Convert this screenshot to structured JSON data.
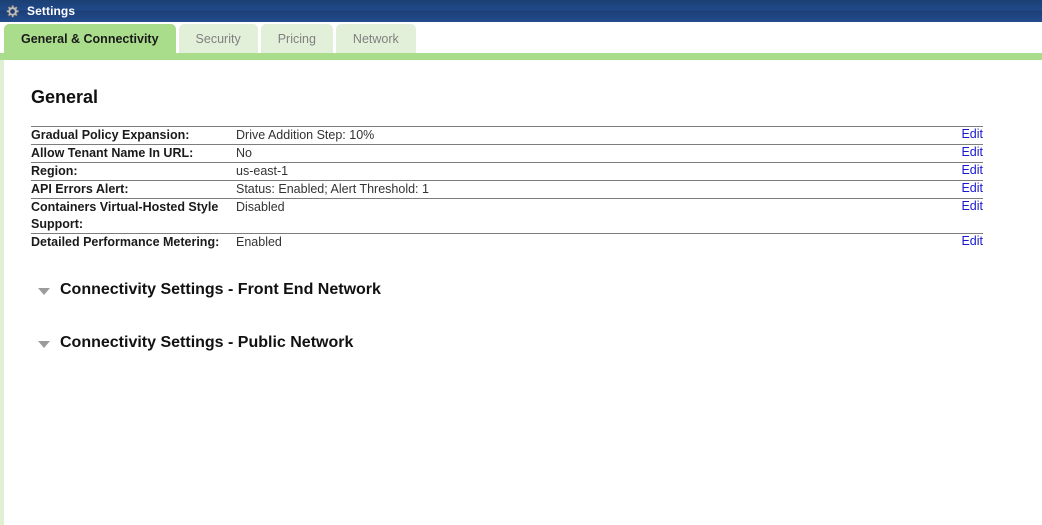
{
  "titlebar": {
    "icon": "gear-icon",
    "title": "Settings"
  },
  "tabs": [
    {
      "label": "General & Connectivity",
      "active": true
    },
    {
      "label": "Security",
      "active": false
    },
    {
      "label": "Pricing",
      "active": false
    },
    {
      "label": "Network",
      "active": false
    }
  ],
  "main": {
    "section_title": "General",
    "edit_label": "Edit",
    "rows": [
      {
        "label": "Gradual Policy Expansion:",
        "value": "Drive Addition Step: 10%",
        "action": "Edit"
      },
      {
        "label": "Allow Tenant Name In URL:",
        "value": "No",
        "action": "Edit"
      },
      {
        "label": "Region:",
        "value": "us-east-1",
        "action": "Edit"
      },
      {
        "label": "API Errors Alert:",
        "value": "Status: Enabled; Alert Threshold: 1",
        "action": "Edit"
      },
      {
        "label": "Containers Virtual-Hosted Style Support:",
        "value": "Disabled",
        "action": "Edit"
      },
      {
        "label": "Detailed Performance Metering:",
        "value": "Enabled",
        "action": "Edit"
      }
    ],
    "collapsibles": [
      {
        "title": "Connectivity Settings - Front End Network",
        "icon": "caret-down-icon",
        "expanded": false
      },
      {
        "title": "Connectivity Settings - Public Network",
        "icon": "caret-down-icon",
        "expanded": false
      }
    ]
  },
  "colors": {
    "titlebar_blue": "#20498a",
    "tab_active_green": "#a9dd8b",
    "tab_inactive_green": "#e2f0d9",
    "link_blue": "#1818d0",
    "divider_gray": "#7d7d7d"
  }
}
